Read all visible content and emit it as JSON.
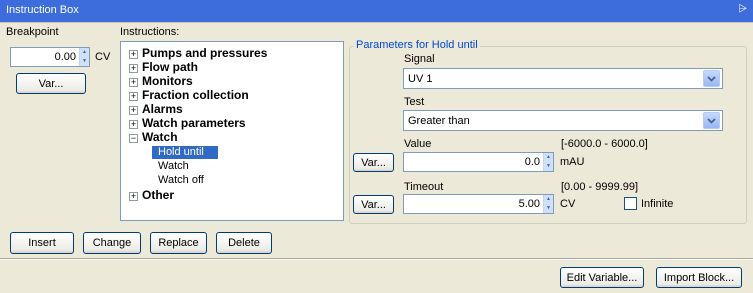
{
  "window": {
    "title": "Instruction Box",
    "pin_glyph": "⩥"
  },
  "breakpoint": {
    "label": "Breakpoint",
    "value": "0.00",
    "unit": "CV",
    "var_button": "Var..."
  },
  "instructions": {
    "label": "Instructions:",
    "tree": [
      {
        "label": "Pumps and pressures",
        "expander": "+"
      },
      {
        "label": "Flow path",
        "expander": "+"
      },
      {
        "label": "Monitors",
        "expander": "+"
      },
      {
        "label": "Fraction collection",
        "expander": "+"
      },
      {
        "label": "Alarms",
        "expander": "+"
      },
      {
        "label": "Watch parameters",
        "expander": "+"
      },
      {
        "label": "Watch",
        "expander": "−",
        "children": [
          "Hold until",
          "Watch",
          "Watch off"
        ],
        "selected_child": "Hold until"
      },
      {
        "label": "Other",
        "expander": "+"
      }
    ]
  },
  "parameters": {
    "legend": "Parameters for Hold until",
    "signal_label": "Signal",
    "signal_value": "UV 1",
    "test_label": "Test",
    "test_value": "Greater than",
    "value_label": "Value",
    "value_range": "[-6000.0 - 6000.0]",
    "value_var_button": "Var...",
    "value_value": "0.0",
    "value_unit": "mAU",
    "timeout_label": "Timeout",
    "timeout_range": "[0.00 - 9999.99]",
    "timeout_var_button": "Var...",
    "timeout_value": "5.00",
    "timeout_unit": "CV",
    "infinite_label": "Infinite",
    "infinite_checked": false
  },
  "actions": {
    "insert": "Insert",
    "change": "Change",
    "replace": "Replace",
    "delete": "Delete"
  },
  "footer": {
    "edit_variable": "Edit Variable...",
    "import_block": "Import Block..."
  },
  "colors": {
    "titlebar": "#3d6ddc",
    "selection": "#316ac5",
    "group_legend": "#0046d5"
  }
}
